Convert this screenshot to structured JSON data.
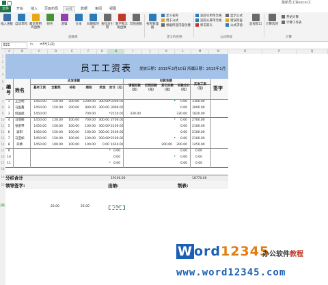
{
  "window": {
    "title": "最新员工资excel工"
  },
  "tabs": [
    "文件",
    "开始",
    "插入",
    "页面布局",
    "公式",
    "数据",
    "审阅",
    "视图"
  ],
  "ribbon": {
    "big_buttons": [
      {
        "label": "插入函数",
        "color": "#3a6ea5"
      },
      {
        "label": "自动求和",
        "color": "#2b7bb9"
      },
      {
        "label": "最近使用的函数",
        "color": "#e6a817"
      },
      {
        "label": "财务",
        "color": "#4c8f3a"
      },
      {
        "label": "逻辑",
        "color": "#8e44ad"
      },
      {
        "label": "文本",
        "color": "#2b7bb9"
      },
      {
        "label": "日期和时间",
        "color": "#2b7bb9"
      },
      {
        "label": "查找与引用",
        "color": "#6a6a6a"
      },
      {
        "label": "数学和三角函数",
        "color": "#c0392b"
      },
      {
        "label": "其他函数",
        "color": "#6a6a6a"
      },
      {
        "label": "名称管理器",
        "color": "#2b7bb9"
      },
      {
        "label": "监视窗口",
        "color": "#6a6a6a"
      },
      {
        "label": "计算选项",
        "color": "#6a6a6a"
      }
    ],
    "small_buttons": [
      "定义名称",
      "用于公式",
      "根据所选内容创建",
      "追踪引用单元格",
      "追踪从属单元格",
      "移去箭头",
      "显示公式",
      "错误检查",
      "公式求值",
      "开始计算",
      "计算工作表"
    ],
    "groups": [
      "函数库",
      "定义的名称",
      "公式审核",
      "计算"
    ]
  },
  "formula_bar": {
    "name_box": "E21",
    "fx": "fx",
    "formula": "=5*(1/2)"
  },
  "columns": [
    "A",
    "B",
    "C",
    "D",
    "E",
    "F",
    "G",
    "H",
    "I",
    "J",
    "K",
    "L",
    "M",
    "N",
    "O",
    "P",
    "Q"
  ],
  "selected_column": "H",
  "rows": [
    "1",
    "2",
    "3",
    "4",
    "5",
    "6",
    "7",
    "8",
    "9",
    "10",
    "11",
    "12",
    "13",
    "14",
    "15",
    "16",
    "17",
    "18",
    "19",
    "20",
    "21",
    "22",
    "23",
    "24",
    "25",
    "26",
    "27",
    "28",
    "29",
    "30",
    "31",
    "32",
    "33",
    "34",
    "35",
    "36",
    "37",
    "38",
    "39",
    "40"
  ],
  "selected_row": "21",
  "sheet": {
    "title": "员工工资表",
    "pay_date": "发放日期：2015年2月10日 所属日期：2015年1月",
    "header": {
      "no": "编号",
      "name": "姓名",
      "payable_group": "应发金额",
      "deduct_group": "扣款金额",
      "payable_cols": [
        "基本工资",
        "全勤奖",
        "补助",
        "绩效",
        "奖金",
        "合计（元）"
      ],
      "deduct_cols": [
        "请假扣款（元）",
        "迟到扣款（元）",
        "其它扣款（元）",
        "扣款合计（元）"
      ],
      "net": "实发工资（元）",
      "sign": "签字"
    },
    "employees": [
      {
        "no": "1",
        "name": "王立明",
        "base": "1450.00",
        "attend": "150.00",
        "allow": "200.00",
        "perf": "1200.00",
        "bonus": "300.00",
        "total": "3300.00",
        "leave": "",
        "late": "",
        "other": "",
        "deduct": "0.00",
        "net": "3300.00"
      },
      {
        "no": "2",
        "name": "马国鑫",
        "base": "1450.00",
        "attend": "150.00",
        "allow": "200.00",
        "perf": "900.00",
        "bonus": "300.00",
        "total": "3000.00",
        "leave": "",
        "late": "",
        "other": "",
        "deduct": "0.00",
        "net": "3000.00"
      },
      {
        "no": "3",
        "name": "何国斌",
        "base": "1450.00",
        "attend": "",
        "allow": "",
        "perf": "700.00",
        "bonus": "",
        "total": "2150.00",
        "leave": "330.00",
        "late": "",
        "other": "",
        "deduct": "330.00",
        "net": "1820.00"
      },
      {
        "no": "4",
        "name": "马亚楠",
        "base": "1450.00",
        "attend": "150.00",
        "allow": "100.00",
        "perf": "700.00",
        "bonus": "300.00",
        "total": "2700.00",
        "leave": "",
        "late": "",
        "other": "",
        "deduct": "0.00",
        "net": "2700.00"
      },
      {
        "no": "5",
        "name": "张爱琴",
        "base": "1450.00",
        "attend": "150.00",
        "allow": "100.00",
        "perf": "100.00",
        "bonus": "300.00",
        "total": "2100.00",
        "leave": "",
        "late": "",
        "other": "",
        "deduct": "0.00",
        "net": "2100.00"
      },
      {
        "no": "6",
        "name": "高阳",
        "base": "1450.00",
        "attend": "150.00",
        "allow": "100.00",
        "perf": "100.00",
        "bonus": "300.00",
        "total": "2100.00",
        "leave": "",
        "late": "",
        "other": "",
        "deduct": "0.00",
        "net": "2100.00"
      },
      {
        "no": "7",
        "name": "马亚如",
        "base": "1450.00",
        "attend": "150.00",
        "allow": "100.00",
        "perf": "100.00",
        "bonus": "300.00",
        "total": "2100.00",
        "leave": "",
        "late": "",
        "other": "",
        "deduct": "0.00",
        "net": "2100.00"
      },
      {
        "no": "8",
        "name": "邓婧",
        "base": "1450.00",
        "attend": "100.00",
        "allow": "100.00",
        "perf": "100.00",
        "bonus": "0.00",
        "total": "1650.00",
        "leave": "",
        "late": "",
        "other": "200.00",
        "deduct": "200.00",
        "net": "1450.00"
      },
      {
        "no": "9",
        "name": "",
        "base": "",
        "attend": "",
        "allow": "",
        "perf": "",
        "bonus": "",
        "total": "0.00",
        "leave": "",
        "late": "",
        "other": "",
        "deduct": "0.00",
        "net": "0.00"
      },
      {
        "no": "10",
        "name": "",
        "base": "",
        "attend": "",
        "allow": "",
        "perf": "",
        "bonus": "",
        "total": "0.00",
        "leave": "",
        "late": "",
        "other": "",
        "deduct": "0.00",
        "net": "0.00"
      },
      {
        "no": "11",
        "name": "",
        "base": "",
        "attend": "",
        "allow": "",
        "perf": "",
        "bonus": "",
        "total": "0.00",
        "leave": "",
        "late": "",
        "other": "",
        "deduct": "0.00",
        "net": "0.00"
      }
    ],
    "subtotal": {
      "label": "分栏合计",
      "total": "19100.00",
      "net": "18770.00"
    },
    "sign_row": {
      "approver": "领导签字:",
      "cashier": "出纳:",
      "preparer": "制表:"
    },
    "extra_values": [
      "25.00",
      "25.00",
      "2.50"
    ]
  },
  "watermark": {
    "logo_w": "W",
    "logo_rest": "ord",
    "logo_num": "12345",
    "cn_a": "办公软件",
    "cn_b": "教程",
    "url": "www.word12345.com"
  }
}
